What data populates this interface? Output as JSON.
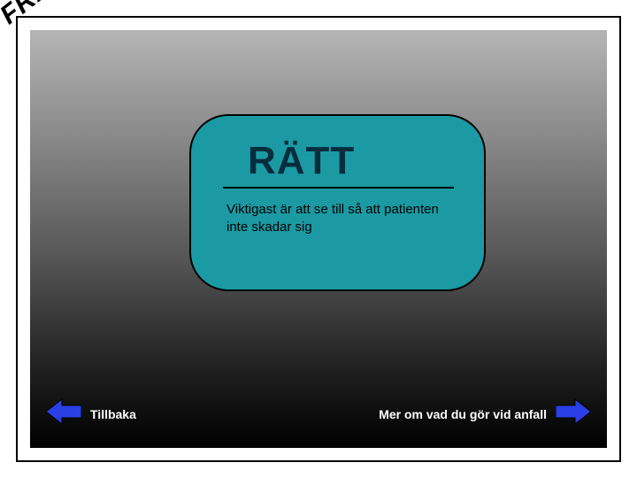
{
  "corner_label": "FRÅGA",
  "card": {
    "title": "RÄTT",
    "body": "Viktigast är att se till så att patienten inte skadar sig"
  },
  "nav": {
    "back_label": "Tillbaka",
    "forward_label": "Mer om vad du gör vid anfall"
  },
  "colors": {
    "card_bg": "#1b9aa3",
    "arrow_fill": "#2b3fe6"
  }
}
